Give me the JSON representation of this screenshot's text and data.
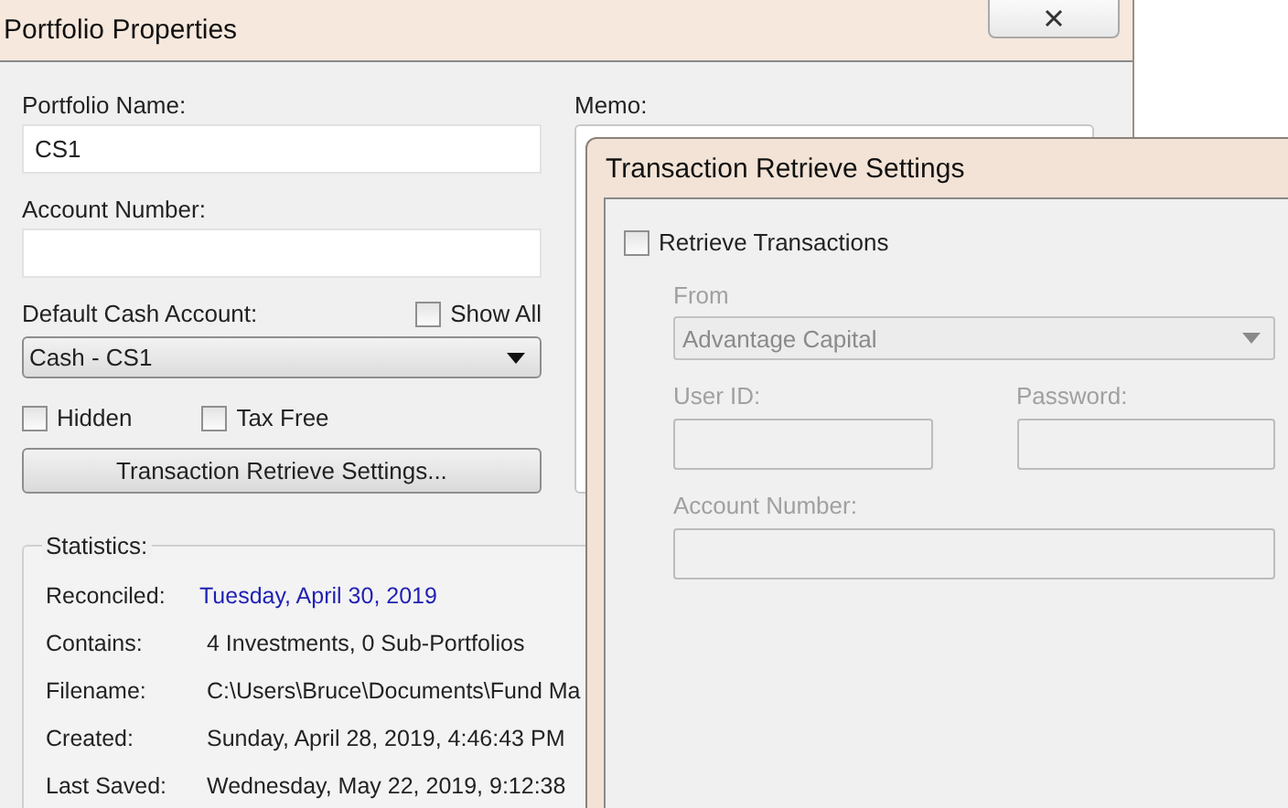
{
  "main_window": {
    "title": "Portfolio Properties",
    "fields": [
      {
        "label": "Portfolio Name:",
        "value": "CS1"
      },
      {
        "label": "Account Number:"
      }
    ],
    "default_cash_account": {
      "label": "Default Cash Account:",
      "value": "Cash - CS1",
      "show_all": {
        "label": "Show All",
        "checked": false
      }
    },
    "checkboxes": [
      {
        "label": "Hidden",
        "checked": false
      },
      {
        "label": "Tax Free",
        "checked": false
      }
    ],
    "button": "Transaction Retrieve Settings...",
    "memo": {
      "label": "Memo:"
    },
    "statistics": {
      "title": "Statistics:",
      "rows": [
        {
          "label": "Reconciled:",
          "value": "Tuesday, April 30, 2019",
          "kind": "link"
        },
        {
          "label": "Contains:",
          "value": "4 Investments, 0 Sub-Portfolios",
          "kind": "text"
        },
        {
          "label": "Filename:",
          "value": "C:\\Users\\Bruce\\Documents\\Fund Ma",
          "kind": "text"
        },
        {
          "label": "Created:",
          "value": "Sunday, April 28, 2019, 4:46:43 PM",
          "kind": "text"
        },
        {
          "label": "Last Saved:",
          "value": "Wednesday, May 22, 2019, 9:12:38",
          "kind": "text"
        }
      ]
    }
  },
  "dialog": {
    "title": "Transaction Retrieve Settings",
    "retrieve": {
      "label": "Retrieve Transactions",
      "checked": false
    },
    "from": {
      "label": "From",
      "value": "Advantage Capital",
      "disabled": true
    },
    "user_id": {
      "label": "User ID:",
      "disabled": true
    },
    "password": {
      "label": "Password:",
      "disabled": true
    },
    "account_number": {
      "label": "Account Number:",
      "disabled": true
    }
  }
}
